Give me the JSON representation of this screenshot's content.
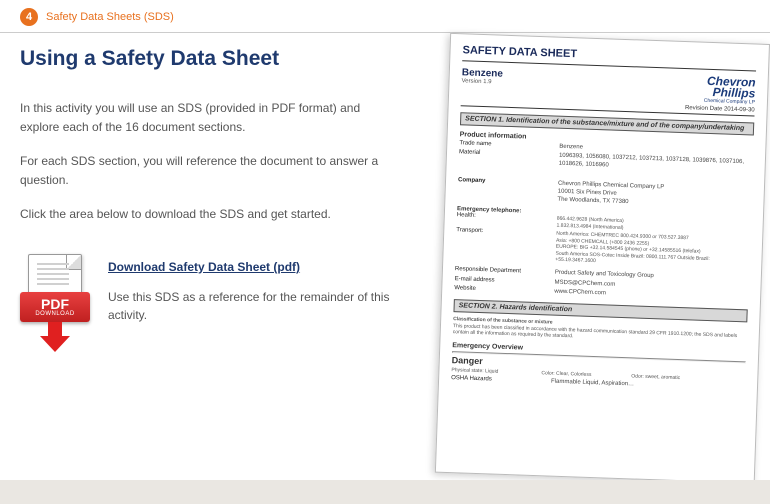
{
  "header": {
    "chapter_num": "4",
    "chapter_title": "Safety Data Sheets (SDS)"
  },
  "main": {
    "title": "Using a Safety Data Sheet",
    "para1": "In this activity you will use an SDS (provided in PDF format) and explore each of the 16 document sections.",
    "para2": "For each SDS section, you will reference the document to answer a question.",
    "para3": "Click the area below to download the SDS and get started.",
    "download_link": "Download Safety Data Sheet (pdf)",
    "download_note": "Use this SDS as a reference for the remainder of this activity.",
    "pdf_badge": "PDF",
    "pdf_badge_sub": "DOWNLOAD"
  },
  "doc": {
    "header": "SAFETY DATA SHEET",
    "compound": "Benzene",
    "version": "Version 1.9",
    "logo_line1": "Chevron",
    "logo_line2": "Phillips",
    "logo_sub": "Chemical Company LP",
    "rev_date": "Revision Date 2014-09-30",
    "section1": "SECTION 1. Identification of the substance/mixture and of the company/undertaking",
    "product_info": "Product information",
    "trade_name_label": "Trade name",
    "trade_name": "Benzene",
    "material_label": "Material",
    "material": "1096393, 1056080, 1037212, 1037213, 1037128, 1039876, 1037106, 1018626, 1016960",
    "company_label": "Company",
    "company": "Chevron Phillips Chemical Company LP\n10001 Six Pines Drive\nThe Woodlands, TX 77380",
    "emerg_label": "Emergency telephone:",
    "health_label": "Health:",
    "health": "866.442.9628 (North America)\n1.832.813.4984 (International)",
    "transport_label": "Transport:",
    "transport": "North America: CHEMTREC 800.424.9300 or 703.527.3887\nAsia: +800 CHEMCALL (+800 2436 2255)\nEUROPE: BIG +32.14.584545 (phone) or +32.14585516 (telefax)\nSouth America SOS-Cotec Inside Brazil: 0800.111.767 Outside Brazil: +55.19.3467.1600",
    "resp_label": "Responsible Department",
    "resp": "Product Safety and Toxicology Group",
    "email_label": "E-mail address",
    "email": "MSDS@CPChem.com",
    "website_label": "Website",
    "website": "www.CPChem.com",
    "section2": "SECTION 2. Hazards identification",
    "class_head": "Classification of the substance or mixture",
    "class_text": "This product has been classified in accordance with the hazard communication standard 29 CFR 1910.1200; the SDS and labels contain all the information as required by the standard.",
    "emerg_overview": "Emergency Overview",
    "danger": "Danger",
    "phys_state_label": "Physical state: Liquid",
    "color_label": "Color: Clear, Colorless",
    "odor_label": "Odor: sweet, aromatic",
    "osha_label": "OSHA Hazards",
    "osha_val": "Flammable Liquid, Aspiration…"
  }
}
